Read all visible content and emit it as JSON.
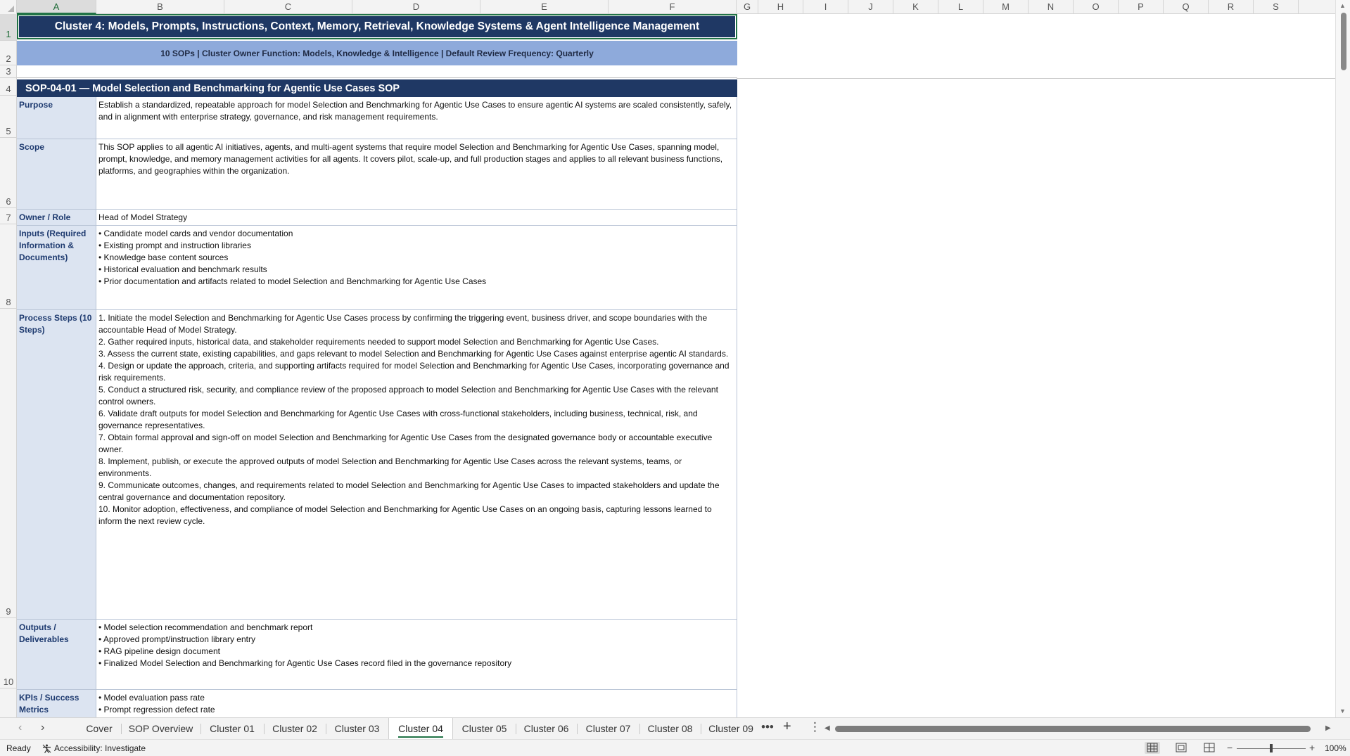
{
  "columns": [
    "A",
    "B",
    "C",
    "D",
    "E",
    "F",
    "G",
    "H",
    "I",
    "J",
    "K",
    "L",
    "M",
    "N",
    "O",
    "P",
    "Q",
    "R",
    "S"
  ],
  "selected_column": "A",
  "rows": [
    "1",
    "2",
    "3",
    "4",
    "5",
    "6",
    "7",
    "8",
    "9",
    "10"
  ],
  "selected_row": "1",
  "title": "Cluster 4: Models, Prompts, Instructions, Context, Memory, Retrieval, Knowledge Systems & Agent Intelligence Management",
  "subtitle": "10 SOPs  |  Cluster Owner Function: Models, Knowledge & Intelligence  |  Default Review Frequency: Quarterly",
  "sop_header": "SOP-04-01  —  Model Selection and Benchmarking for Agentic Use Cases SOP",
  "fields": [
    {
      "label": "Purpose",
      "value": "Establish a standardized, repeatable approach for model Selection and Benchmarking for Agentic Use Cases to ensure agentic AI systems are scaled consistently, safely, and in alignment with enterprise strategy, governance, and risk management requirements."
    },
    {
      "label": "Scope",
      "value": "This SOP applies to all agentic AI initiatives, agents, and multi-agent systems that require model Selection and Benchmarking for Agentic Use Cases, spanning model, prompt, knowledge, and memory management activities for all agents. It covers pilot, scale-up, and full production stages and applies to all relevant business functions, platforms, and geographies within the organization."
    },
    {
      "label": "Owner / Role",
      "value": "Head of Model Strategy"
    },
    {
      "label": "Inputs (Required Information & Documents)",
      "value": "• Candidate model cards and vendor documentation\n• Existing prompt and instruction libraries\n• Knowledge base content sources\n• Historical evaluation and benchmark results\n• Prior documentation and artifacts related to model Selection and Benchmarking for Agentic Use Cases"
    },
    {
      "label": "Process Steps (10 Steps)",
      "value": "1. Initiate the model Selection and Benchmarking for Agentic Use Cases process by confirming the triggering event, business driver, and scope boundaries with the accountable Head of Model Strategy.\n2. Gather required inputs, historical data, and stakeholder requirements needed to support model Selection and Benchmarking for Agentic Use Cases.\n3. Assess the current state, existing capabilities, and gaps relevant to model Selection and Benchmarking for Agentic Use Cases against enterprise agentic AI standards.\n4. Design or update the approach, criteria, and supporting artifacts required for model Selection and Benchmarking for Agentic Use Cases, incorporating governance and risk requirements.\n5. Conduct a structured risk, security, and compliance review of the proposed approach to model Selection and Benchmarking for Agentic Use Cases with the relevant control owners.\n6. Validate draft outputs for model Selection and Benchmarking for Agentic Use Cases with cross-functional stakeholders, including business, technical, risk, and governance representatives.\n7. Obtain formal approval and sign-off on model Selection and Benchmarking for Agentic Use Cases from the designated governance body or accountable executive owner.\n8. Implement, publish, or execute the approved outputs of model Selection and Benchmarking for Agentic Use Cases across the relevant systems, teams, or environments.\n9. Communicate outcomes, changes, and requirements related to model Selection and Benchmarking for Agentic Use Cases to impacted stakeholders and update the central governance and documentation repository.\n10. Monitor adoption, effectiveness, and compliance of model Selection and Benchmarking for Agentic Use Cases on an ongoing basis, capturing lessons learned to inform the next review cycle."
    },
    {
      "label": "Outputs / Deliverables",
      "value": "• Model selection recommendation and benchmark report\n• Approved prompt/instruction library entry\n• RAG pipeline design document\n• Finalized Model Selection and Benchmarking for Agentic Use Cases record filed in the governance repository"
    },
    {
      "label": "KPIs / Success Metrics",
      "value": "• Model evaluation pass rate\n• Prompt regression defect rate"
    }
  ],
  "sheet_tabs": [
    "Cover",
    "SOP Overview",
    "Cluster 01",
    "Cluster 02",
    "Cluster 03",
    "Cluster 04",
    "Cluster 05",
    "Cluster 06",
    "Cluster 07",
    "Cluster 08",
    "Cluster 09"
  ],
  "active_tab": "Cluster 04",
  "status": {
    "ready": "Ready",
    "accessibility": "Accessibility: Investigate",
    "zoom": "100%",
    "zoom_fraction": 0.5
  },
  "icons": [
    "prev-sheet-icon",
    "next-sheet-icon",
    "more-sheets-icon",
    "add-sheet-icon",
    "sheet-options-icon",
    "accessibility-icon",
    "normal-view-icon",
    "page-layout-icon",
    "page-break-icon"
  ]
}
